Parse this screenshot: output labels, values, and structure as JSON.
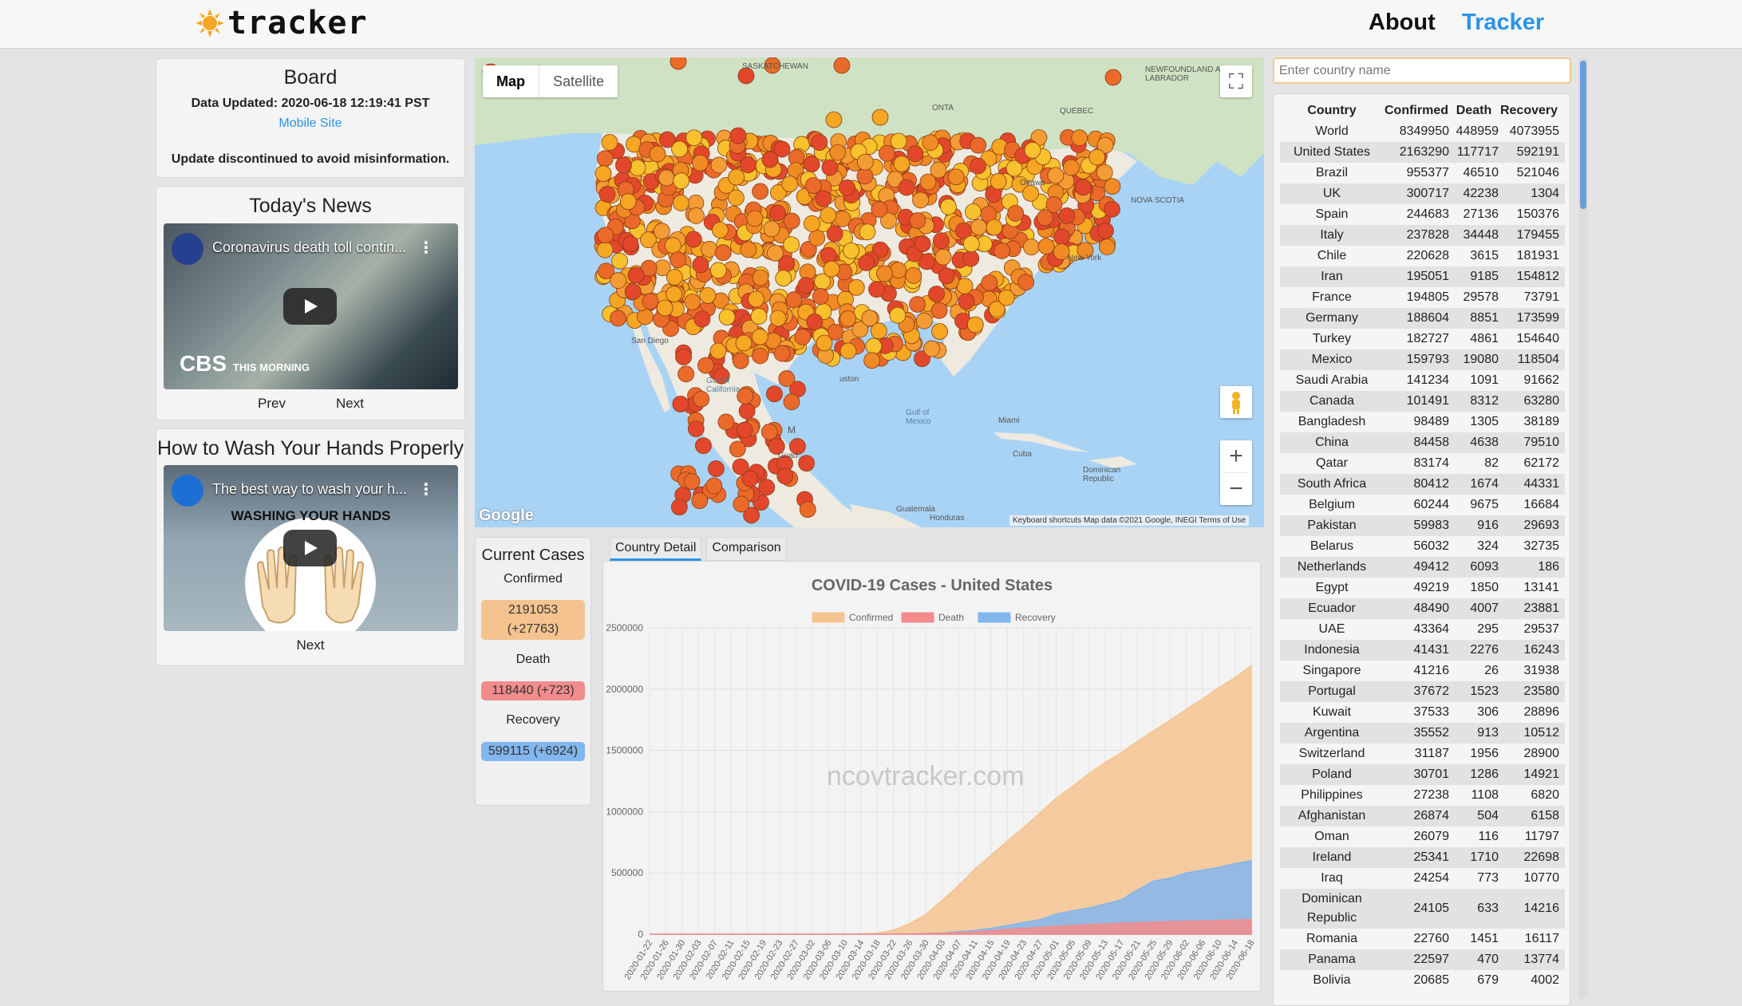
{
  "header": {
    "logo_text": "tracker",
    "nav": {
      "about": "About",
      "tracker": "Tracker"
    }
  },
  "board": {
    "title": "Board",
    "updated": "Data Updated: 2020-06-18 12:19:41 PST",
    "mobile_link": "Mobile Site",
    "notice": "Update discontinued to avoid misinformation."
  },
  "news": {
    "title": "Today's News",
    "video_title": "Coronavirus death toll contin...",
    "channel_logo": "CBS",
    "channel_sub": "THIS MORNING",
    "prev": "Prev",
    "next": "Next"
  },
  "wash": {
    "title": "How to Wash Your Hands Properly",
    "video_title": "The best way to wash your h...",
    "caption": "WASHING YOUR HANDS",
    "next": "Next"
  },
  "map": {
    "tab_map": "Map",
    "tab_satellite": "Satellite",
    "google": "Google",
    "attribution": "Keyboard shortcuts   Map data ©2021 Google, INEGI   Terms of Use",
    "labels": {
      "saskatchewan": "SASKATCHEWAN",
      "newfoundland": "NEWFOUNDLAND AND LABRADOR",
      "ontario": "ONTA",
      "quebec": "QUEBEC",
      "ottawa": "Ottawa",
      "nova_scotia": "NOVA SCOTIA",
      "new_york": "New York",
      "san_diego": "San Diego",
      "houston": "uston",
      "miami": "Miami",
      "gulf": "Gulf of Mexico",
      "cuba": "Cuba",
      "gulf_ca": "Gulf of California",
      "mexico": "M",
      "guatemala": "Guatemala",
      "honduras": "Honduras",
      "dominican": "Dominican Republic",
      "guad": "Guad"
    }
  },
  "current": {
    "title": "Current Cases",
    "confirmed_label": "Confirmed",
    "confirmed_value": "2191053",
    "confirmed_delta": "(+27763)",
    "death_label": "Death",
    "death_value": "118440 (+723)",
    "recovery_label": "Recovery",
    "recovery_value": "599115 (+6924)"
  },
  "tabs": {
    "detail": "Country Detail",
    "comparison": "Comparison"
  },
  "chart_data": {
    "type": "area",
    "title": "COVID-19 Cases  -  United States",
    "watermark": "ncovtracker.com",
    "legend_position": "top",
    "y_ticks": [
      "0",
      "500000",
      "1000000",
      "1500000",
      "2000000",
      "2500000"
    ],
    "ylim": [
      0,
      2500000
    ],
    "x": [
      "2020-01-22",
      "2020-01-26",
      "2020-01-30",
      "2020-02-03",
      "2020-02-07",
      "2020-02-11",
      "2020-02-15",
      "2020-02-19",
      "2020-02-23",
      "2020-02-27",
      "2020-03-02",
      "2020-03-06",
      "2020-03-10",
      "2020-03-14",
      "2020-03-18",
      "2020-03-22",
      "2020-03-26",
      "2020-03-30",
      "2020-04-03",
      "2020-04-07",
      "2020-04-11",
      "2020-04-15",
      "2020-04-19",
      "2020-04-23",
      "2020-04-27",
      "2020-05-01",
      "2020-05-05",
      "2020-05-09",
      "2020-05-13",
      "2020-05-17",
      "2020-05-21",
      "2020-05-25",
      "2020-05-29",
      "2020-06-02",
      "2020-06-06",
      "2020-06-10",
      "2020-06-14",
      "2020-06-18"
    ],
    "series": [
      {
        "name": "Confirmed",
        "color": "#f5c38f",
        "values": [
          1,
          5,
          6,
          11,
          12,
          13,
          15,
          15,
          15,
          60,
          100,
          260,
          1000,
          2700,
          7800,
          33000,
          86000,
          163000,
          277000,
          396000,
          530000,
          644000,
          760000,
          870000,
          988000,
          1110000,
          1204000,
          1310000,
          1400000,
          1480000,
          1575000,
          1660000,
          1745000,
          1835000,
          1920000,
          2010000,
          2095000,
          2191053
        ]
      },
      {
        "name": "Death",
        "color": "#f28c8c",
        "values": [
          0,
          0,
          0,
          0,
          0,
          0,
          0,
          0,
          0,
          0,
          6,
          14,
          31,
          58,
          150,
          430,
          1300,
          3200,
          7400,
          13000,
          20500,
          28000,
          40000,
          48000,
          56000,
          64000,
          71000,
          78000,
          84000,
          89000,
          94000,
          98000,
          102000,
          106000,
          109000,
          112000,
          115000,
          118440
        ]
      },
      {
        "name": "Recovery",
        "color": "#82b6ee",
        "values": [
          0,
          0,
          0,
          0,
          0,
          0,
          3,
          3,
          5,
          7,
          7,
          8,
          8,
          12,
          106,
          178,
          753,
          5900,
          9700,
          21700,
          31000,
          48000,
          71000,
          95000,
          118000,
          164000,
          190000,
          212000,
          246000,
          280000,
          362000,
          433000,
          457000,
          500000,
          522000,
          545000,
          576000,
          599115
        ]
      }
    ]
  },
  "search": {
    "placeholder": "Enter country name"
  },
  "countries": {
    "headers": [
      "Country",
      "Confirmed",
      "Death",
      "Recovery"
    ],
    "rows": [
      [
        "World",
        "8349950",
        "448959",
        "4073955"
      ],
      [
        "United States",
        "2163290",
        "117717",
        "592191"
      ],
      [
        "Brazil",
        "955377",
        "46510",
        "521046"
      ],
      [
        "UK",
        "300717",
        "42238",
        "1304"
      ],
      [
        "Spain",
        "244683",
        "27136",
        "150376"
      ],
      [
        "Italy",
        "237828",
        "34448",
        "179455"
      ],
      [
        "Chile",
        "220628",
        "3615",
        "181931"
      ],
      [
        "Iran",
        "195051",
        "9185",
        "154812"
      ],
      [
        "France",
        "194805",
        "29578",
        "73791"
      ],
      [
        "Germany",
        "188604",
        "8851",
        "173599"
      ],
      [
        "Turkey",
        "182727",
        "4861",
        "154640"
      ],
      [
        "Mexico",
        "159793",
        "19080",
        "118504"
      ],
      [
        "Saudi Arabia",
        "141234",
        "1091",
        "91662"
      ],
      [
        "Canada",
        "101491",
        "8312",
        "63280"
      ],
      [
        "Bangladesh",
        "98489",
        "1305",
        "38189"
      ],
      [
        "China",
        "84458",
        "4638",
        "79510"
      ],
      [
        "Qatar",
        "83174",
        "82",
        "62172"
      ],
      [
        "South Africa",
        "80412",
        "1674",
        "44331"
      ],
      [
        "Belgium",
        "60244",
        "9675",
        "16684"
      ],
      [
        "Pakistan",
        "59983",
        "916",
        "29693"
      ],
      [
        "Belarus",
        "56032",
        "324",
        "32735"
      ],
      [
        "Netherlands",
        "49412",
        "6093",
        "186"
      ],
      [
        "Egypt",
        "49219",
        "1850",
        "13141"
      ],
      [
        "Ecuador",
        "48490",
        "4007",
        "23881"
      ],
      [
        "UAE",
        "43364",
        "295",
        "29537"
      ],
      [
        "Indonesia",
        "41431",
        "2276",
        "16243"
      ],
      [
        "Singapore",
        "41216",
        "26",
        "31938"
      ],
      [
        "Portugal",
        "37672",
        "1523",
        "23580"
      ],
      [
        "Kuwait",
        "37533",
        "306",
        "28896"
      ],
      [
        "Argentina",
        "35552",
        "913",
        "10512"
      ],
      [
        "Switzerland",
        "31187",
        "1956",
        "28900"
      ],
      [
        "Poland",
        "30701",
        "1286",
        "14921"
      ],
      [
        "Philippines",
        "27238",
        "1108",
        "6820"
      ],
      [
        "Afghanistan",
        "26874",
        "504",
        "6158"
      ],
      [
        "Oman",
        "26079",
        "116",
        "11797"
      ],
      [
        "Ireland",
        "25341",
        "1710",
        "22698"
      ],
      [
        "Iraq",
        "24254",
        "773",
        "10770"
      ],
      [
        "Dominican Republic",
        "24105",
        "633",
        "14216"
      ],
      [
        "Romania",
        "22760",
        "1451",
        "16117"
      ],
      [
        "Panama",
        "22597",
        "470",
        "13774"
      ],
      [
        "Bolivia",
        "20685",
        "679",
        "4002"
      ]
    ]
  }
}
